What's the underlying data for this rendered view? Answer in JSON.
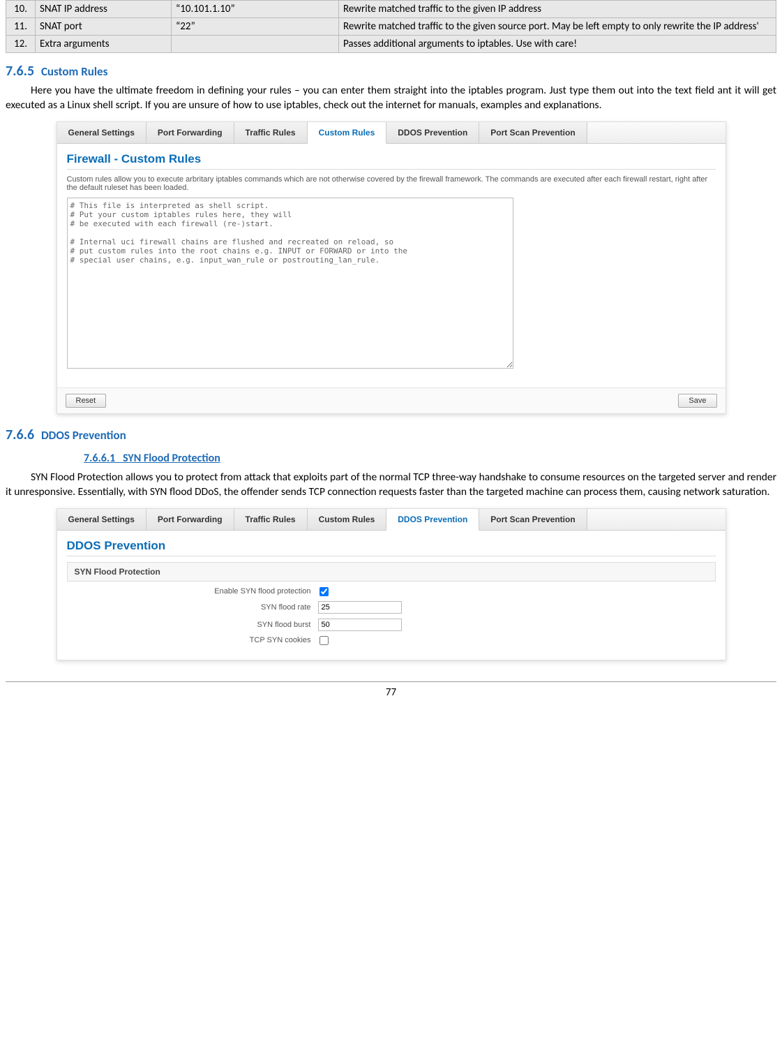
{
  "table": {
    "rows": [
      {
        "n": "10.",
        "name": "SNAT IP address",
        "val": "“10.101.1.10”",
        "desc": "Rewrite matched traffic to the given IP address"
      },
      {
        "n": "11.",
        "name": "SNAT port",
        "val": "“22”",
        "desc": "Rewrite matched traffic to the given source port. May be left empty to only rewrite the IP address'"
      },
      {
        "n": "12.",
        "name": "Extra arguments",
        "val": "",
        "desc": "Passes additional arguments to iptables. Use with care!"
      }
    ]
  },
  "sec765": {
    "num": "7.6.5",
    "title": "Custom Rules",
    "para": "Here you have the ultimate freedom in defining your rules – you can enter them straight into the iptables program. Just type them out into the text field ant it will get executed as a Linux shell script. If you are unsure of how to use iptables, check out the internet for manuals, examples and explanations."
  },
  "shot1": {
    "tabs": [
      "General Settings",
      "Port Forwarding",
      "Traffic Rules",
      "Custom Rules",
      "DDOS Prevention",
      "Port Scan Prevention"
    ],
    "active": 3,
    "heading": "Firewall - Custom Rules",
    "desc": "Custom rules allow you to execute arbritary iptables commands which are not otherwise covered by the firewall framework. The commands are executed after each firewall restart, right after the default ruleset has been loaded.",
    "textarea": "# This file is interpreted as shell script.\n# Put your custom iptables rules here, they will\n# be executed with each firewall (re-)start.\n\n# Internal uci firewall chains are flushed and recreated on reload, so\n# put custom rules into the root chains e.g. INPUT or FORWARD or into the\n# special user chains, e.g. input_wan_rule or postrouting_lan_rule.",
    "reset": "Reset",
    "save": "Save"
  },
  "sec766": {
    "num": "7.6.6",
    "title": "DDOS Prevention",
    "sub_num": "7.6.6.1",
    "sub_title": "SYN Flood Protection",
    "para": "SYN Flood Protection allows you to protect from attack that exploits part of the normal TCP three-way handshake to consume resources on the targeted server and render it unresponsive. Essentially, with SYN flood DDoS, the offender sends TCP connection requests faster than the targeted machine can process them, causing network saturation."
  },
  "shot2": {
    "tabs": [
      "General Settings",
      "Port Forwarding",
      "Traffic Rules",
      "Custom Rules",
      "DDOS Prevention",
      "Port Scan Prevention"
    ],
    "active": 4,
    "heading": "DDOS Prevention",
    "section_label": "SYN Flood Protection",
    "rows": [
      {
        "label": "Enable SYN flood protection",
        "type": "checkbox",
        "checked": true
      },
      {
        "label": "SYN flood rate",
        "type": "text",
        "value": "25"
      },
      {
        "label": "SYN flood burst",
        "type": "text",
        "value": "50"
      },
      {
        "label": "TCP SYN cookies",
        "type": "checkbox",
        "checked": false
      }
    ]
  },
  "page": "77"
}
